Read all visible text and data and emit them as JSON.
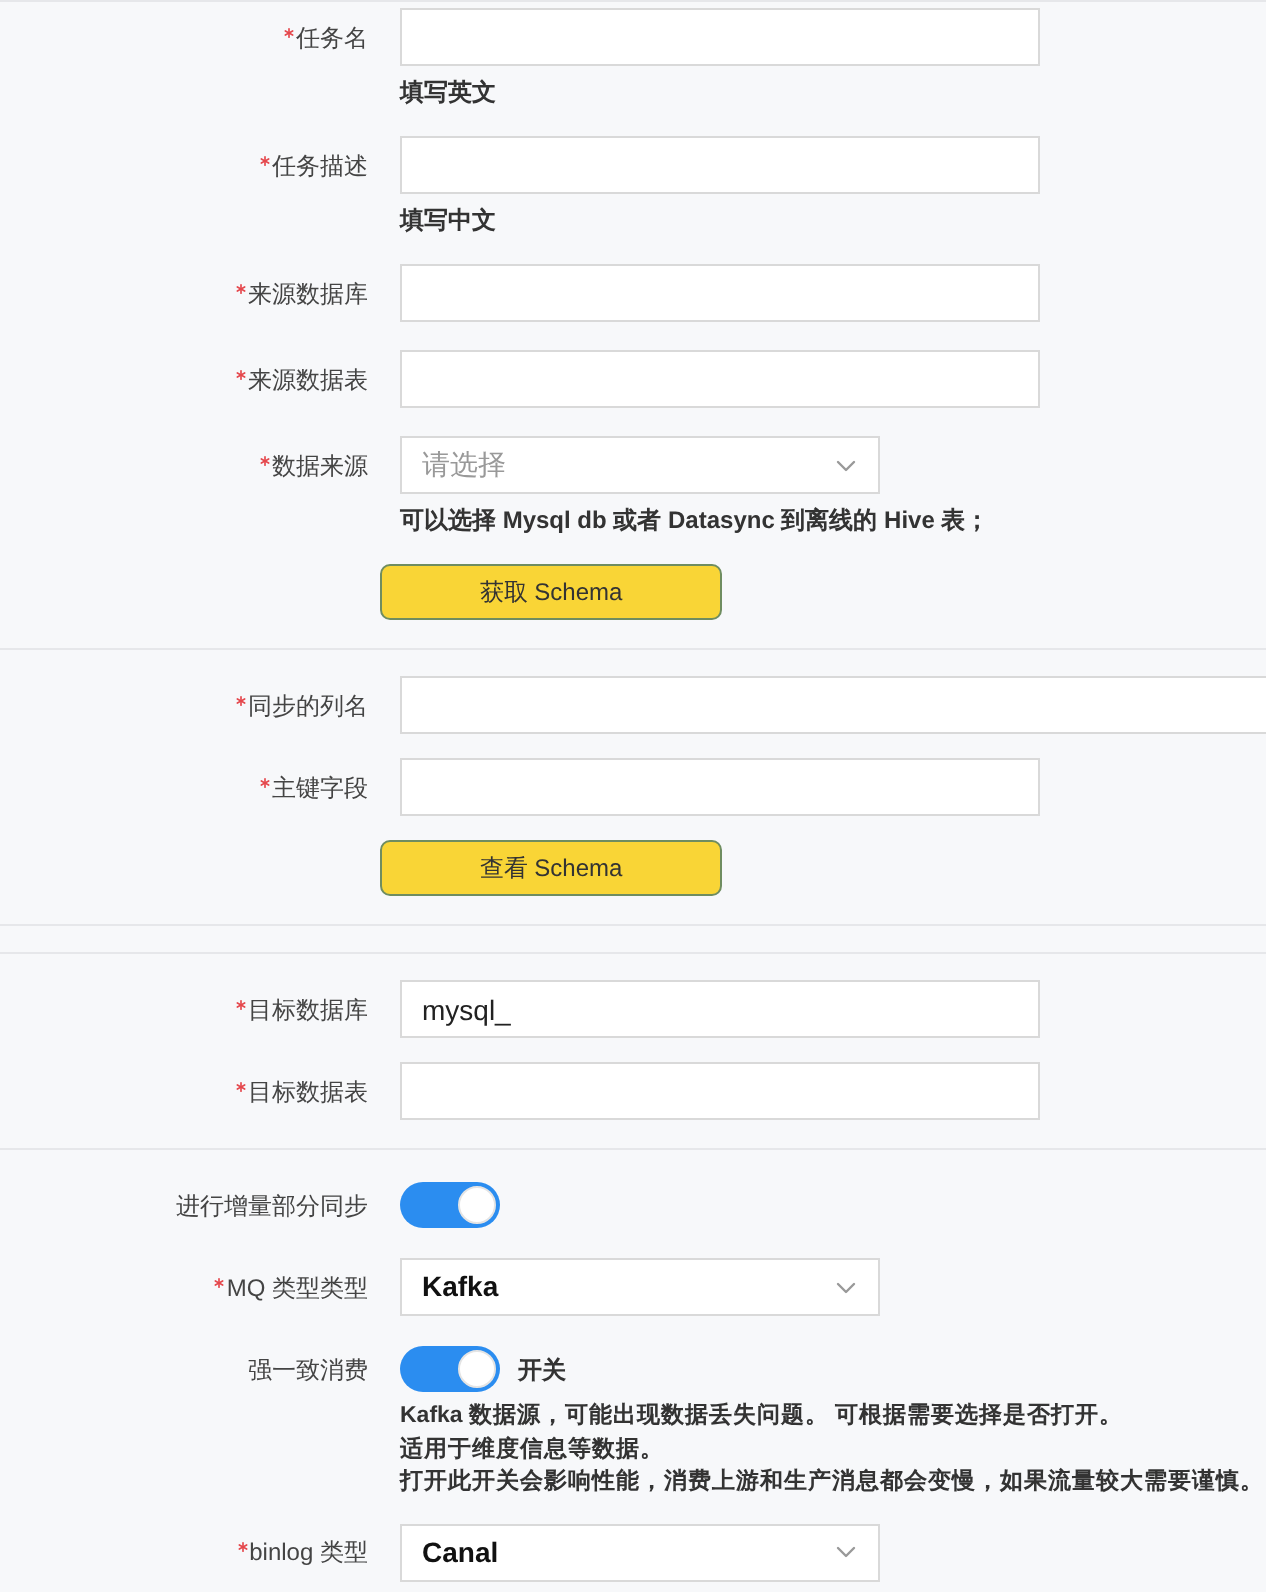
{
  "cards": [
    {
      "sections": [
        {
          "fields": [
            {
              "kind": "input",
              "label": "任务名",
              "required": true,
              "hint": "填写英文"
            },
            {
              "kind": "input",
              "label": "任务描述",
              "required": true,
              "hint": "填写中文"
            },
            {
              "kind": "input",
              "label": "来源数据库",
              "required": true
            },
            {
              "kind": "input",
              "label": "来源数据表",
              "required": true
            },
            {
              "kind": "select",
              "label": "数据来源",
              "required": true,
              "placeholder": "请选择",
              "hint": "可以选择 Mysql db 或者 Datasync 到离线的 Hive 表；"
            },
            {
              "kind": "button",
              "label": "获取 Schema"
            }
          ]
        },
        {
          "fields": [
            {
              "kind": "long_input",
              "label": "同步的列名",
              "required": true
            },
            {
              "kind": "input",
              "label": "主键字段",
              "required": true
            },
            {
              "kind": "button",
              "label": "查看 Schema"
            }
          ]
        }
      ]
    },
    {
      "sections": [
        {
          "fields": [
            {
              "kind": "input",
              "label": "目标数据库",
              "required": true,
              "value": "mysql_"
            },
            {
              "kind": "input",
              "label": "目标数据表",
              "required": true
            }
          ]
        },
        {
          "fields": [
            {
              "kind": "switch",
              "label": "进行增量部分同步",
              "required": false,
              "on": true
            },
            {
              "kind": "select",
              "label": "MQ 类型类型",
              "required": true,
              "value": "Kafka"
            },
            {
              "kind": "switch",
              "label": "强一致消费",
              "required": false,
              "on": true,
              "switch_label": "开关",
              "notes": [
                "Kafka 数据源，可能出现数据丢失问题。 可根据需要选择是否打开。",
                "适用于维度信息等数据。",
                "打开此开关会影响性能，消费上游和生产消息都会变慢，如果流量较大需要谨慎。"
              ]
            },
            {
              "kind": "select",
              "label": "binlog 类型",
              "required": true,
              "value": "Canal"
            }
          ]
        }
      ]
    }
  ]
}
